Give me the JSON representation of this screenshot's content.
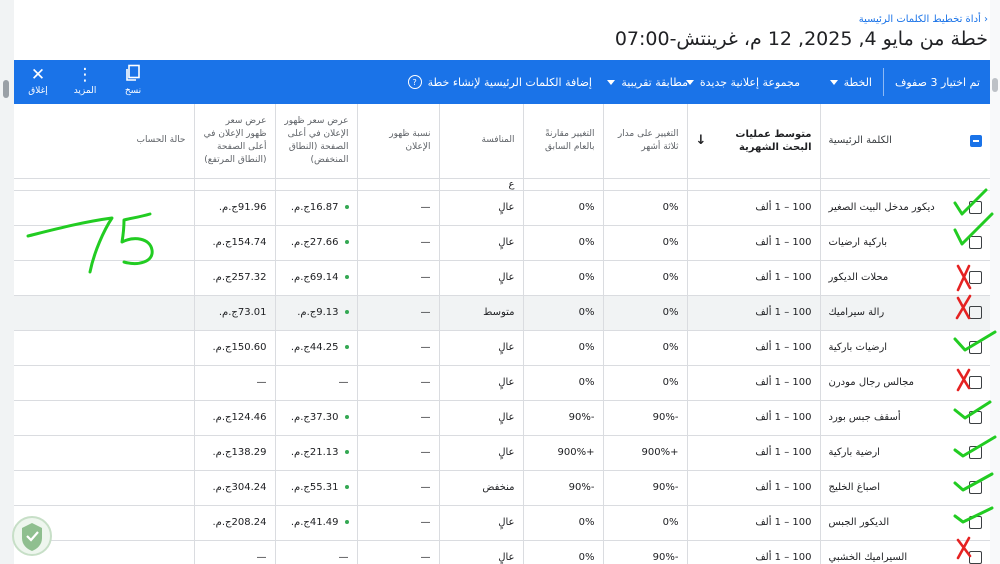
{
  "breadcrumb": "أداة تخطيط الكلمات الرئيسية",
  "page_title": "خطة من مايو 4, 2025, 12 م، غرينتش-07:00",
  "toolbar": {
    "selected_label": "تم اختيار 3 صفوف",
    "plan_label": "الخطة",
    "adgroup_label": "مجموعة إعلانية جديدة",
    "match_label": "مطابقة تقريبية",
    "add_label": "إضافة الكلمات الرئيسية لإنشاء خطة",
    "copy_label": "نسخ",
    "more_label": "المزيد",
    "close_label": "إغلاق",
    "accent": "#1a73e8"
  },
  "table": {
    "headers": {
      "keyword": "الكلمة الرئيسية",
      "avg_searches": "متوسط عمليات البحث الشهرية",
      "three_month": "التغيير على مدار ثلاثة أشهر",
      "yoy": "التغيير مقارنةً بالعام السابق",
      "competition": "المنافسة",
      "impression_share": "نسبة ظهور الإعلان",
      "low_bid": "عرض سعر ظهور الإعلان في أعلى الصفحة (النطاق المنخفض)",
      "high_bid": "عرض سعر ظهور الإعلان في أعلى الصفحة (النطاق المرتفع)",
      "account_status": "حالة الحساب"
    },
    "partial_row": {
      "competition": "ع"
    },
    "rows": [
      {
        "keyword": "ديكور مدخل البيت الصغير",
        "searches": "100 – 1 ألف",
        "three_month": "0%",
        "yoy": "0%",
        "competition": "عالٍ",
        "share": "—",
        "low": "16.87ج.م.",
        "high": "91.96ج.م."
      },
      {
        "keyword": "باركية ارضيات",
        "searches": "100 – 1 ألف",
        "three_month": "0%",
        "yoy": "0%",
        "competition": "عالٍ",
        "share": "—",
        "low": "27.66ج.م.",
        "high": "154.74ج.م."
      },
      {
        "keyword": "محلات الديكور",
        "searches": "100 – 1 ألف",
        "three_month": "0%",
        "yoy": "0%",
        "competition": "عالٍ",
        "share": "—",
        "low": "69.14ج.م.",
        "high": "257.32ج.م."
      },
      {
        "keyword": "رالة سيراميك",
        "searches": "100 – 1 ألف",
        "three_month": "0%",
        "yoy": "0%",
        "competition": "متوسط",
        "share": "—",
        "low": "9.13ج.م.",
        "high": "73.01ج.م."
      },
      {
        "keyword": "ارضيات باركية",
        "searches": "100 – 1 ألف",
        "three_month": "0%",
        "yoy": "0%",
        "competition": "عالٍ",
        "share": "—",
        "low": "44.25ج.م.",
        "high": "150.60ج.م."
      },
      {
        "keyword": "مجالس رجال مودرن",
        "searches": "100 – 1 ألف",
        "three_month": "0%",
        "yoy": "0%",
        "competition": "عالٍ",
        "share": "—",
        "low": "—",
        "high": "—"
      },
      {
        "keyword": "أسقف جبس بورد",
        "searches": "100 – 1 ألف",
        "three_month": "-90%",
        "yoy": "-90%",
        "competition": "عالٍ",
        "share": "—",
        "low": "37.30ج.م.",
        "high": "124.46ج.م."
      },
      {
        "keyword": "ارضية باركية",
        "searches": "100 – 1 ألف",
        "three_month": "+900%",
        "yoy": "+900%",
        "competition": "عالٍ",
        "share": "—",
        "low": "21.13ج.م.",
        "high": "138.29ج.م."
      },
      {
        "keyword": "اصباغ الخليج",
        "searches": "100 – 1 ألف",
        "three_month": "-90%",
        "yoy": "-90%",
        "competition": "منخفض",
        "share": "—",
        "low": "55.31ج.م.",
        "high": "304.24ج.م."
      },
      {
        "keyword": "الديكور الجبس",
        "searches": "100 – 1 ألف",
        "three_month": "0%",
        "yoy": "0%",
        "competition": "عالٍ",
        "share": "—",
        "low": "41.49ج.م.",
        "high": "208.24ج.م."
      },
      {
        "keyword": "السيراميك الخشبي",
        "searches": "100 – 1 ألف",
        "three_month": "-90%",
        "yoy": "0%",
        "competition": "عالٍ",
        "share": "—",
        "low": "—",
        "high": "—"
      }
    ]
  }
}
